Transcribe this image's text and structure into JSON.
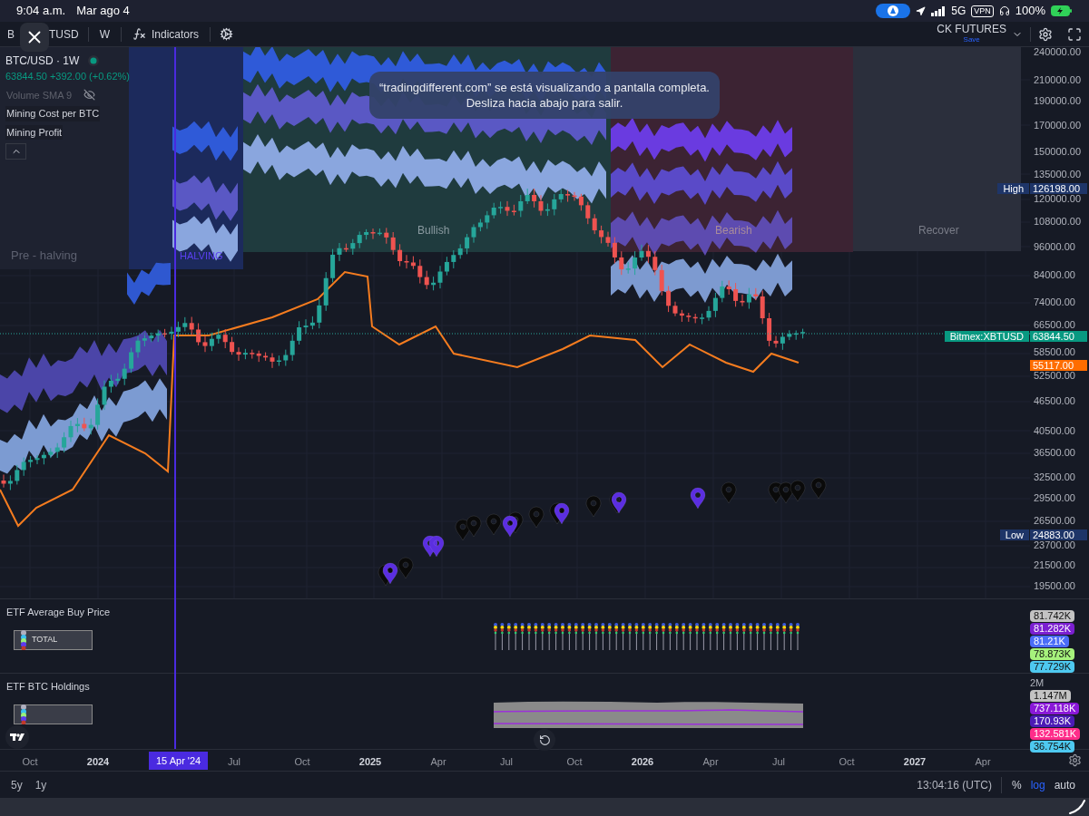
{
  "status_bar": {
    "time": "9:04 a.m.",
    "date": "Mar ago 4",
    "network": "5G",
    "vpn": "VPN",
    "battery": "100%"
  },
  "toolbar": {
    "symbol_start": "B",
    "symbol_end": "TUSD",
    "interval": "W",
    "indicators": "Indicators",
    "layout_name": "CK FUTURES",
    "save": "Save"
  },
  "legend": {
    "title": "BTC/USD · 1W",
    "quote": "63844.50 +392.00 (+0.62%)",
    "indicators": [
      {
        "name": "Volume SMA 9",
        "hidden": true
      },
      {
        "name": "Mining Cost per BTC",
        "hidden": false
      },
      {
        "name": "Mining Profit",
        "hidden": false
      }
    ]
  },
  "zones": [
    {
      "label": "Pre - halving"
    },
    {
      "label": "HALVING"
    },
    {
      "label": "Bullish"
    },
    {
      "label": "Bearish"
    },
    {
      "label": "Recover"
    }
  ],
  "notice": [
    "“tradingdifferent.com” se está visualizando a pantalla completa.",
    "Desliza hacia abajo para salir."
  ],
  "price_axis": [
    "240000.00",
    "210000.00",
    "190000.00",
    "170000.00",
    "150000.00",
    "135000.00",
    "120000.00",
    "108000.00",
    "96000.00",
    "84000.00",
    "74000.00",
    "66500.00",
    "58500.00",
    "52500.00",
    "46500.00",
    "40500.00",
    "36500.00",
    "32500.00",
    "29500.00",
    "26500.00",
    "23700.00",
    "21500.00",
    "19500.00"
  ],
  "price_markers": [
    {
      "kind": "range",
      "label": "High",
      "value": "126198.00"
    },
    {
      "kind": "last",
      "label": "Bitmex:XBTUSD",
      "value": "63844.50",
      "color": "#089981"
    },
    {
      "kind": "plain",
      "value": "55117.00",
      "color": "#ff6d00"
    },
    {
      "kind": "range",
      "label": "Low",
      "value": "24883.00"
    }
  ],
  "panes": [
    {
      "title": "ETF Average Buy Price",
      "legend": "TOTAL",
      "kind": "lollipop",
      "badges": [
        {
          "value": "81.742K",
          "color": "#c3c3c3"
        },
        {
          "value": "81.282K",
          "color": "#7b1fd1"
        },
        {
          "value": "81.21K",
          "color": "#4a6cf7"
        },
        {
          "value": "78.873K",
          "color": "#a6f27c"
        },
        {
          "value": "77.729K",
          "color": "#4ec9f0"
        }
      ]
    },
    {
      "title": "ETF BTC Holdings",
      "kind": "area",
      "tick": "2M",
      "badges": [
        {
          "value": "1.147M",
          "color": "#c3c3c3"
        },
        {
          "value": "737.118K",
          "color": "#8a18d8"
        },
        {
          "value": "170.93K",
          "color": "#4c1bb5"
        },
        {
          "value": "132.581K",
          "color": "#ff2d8a"
        },
        {
          "value": "36.754K",
          "color": "#4ec9f0"
        }
      ]
    }
  ],
  "time_axis": {
    "crosshair": "15 Apr '24",
    "ticks": [
      {
        "label": "Oct",
        "year": false
      },
      {
        "label": "2024",
        "year": true
      },
      {
        "label": "Jul",
        "year": false
      },
      {
        "label": "Oct",
        "year": false
      },
      {
        "label": "2025",
        "year": true
      },
      {
        "label": "Apr",
        "year": false
      },
      {
        "label": "Jul",
        "year": false
      },
      {
        "label": "Oct",
        "year": false
      },
      {
        "label": "2026",
        "year": true
      },
      {
        "label": "Apr",
        "year": false
      },
      {
        "label": "Jul",
        "year": false
      },
      {
        "label": "Oct",
        "year": false
      },
      {
        "label": "2027",
        "year": true
      },
      {
        "label": "Apr",
        "year": false
      }
    ]
  },
  "bottom_bar": {
    "ranges": [
      "5y",
      "1y"
    ],
    "clock": "13:04:16 (UTC)",
    "scale_modes": [
      {
        "label": "%",
        "selected": false
      },
      {
        "label": "log",
        "selected": true
      },
      {
        "label": "auto",
        "selected": false
      }
    ]
  }
}
